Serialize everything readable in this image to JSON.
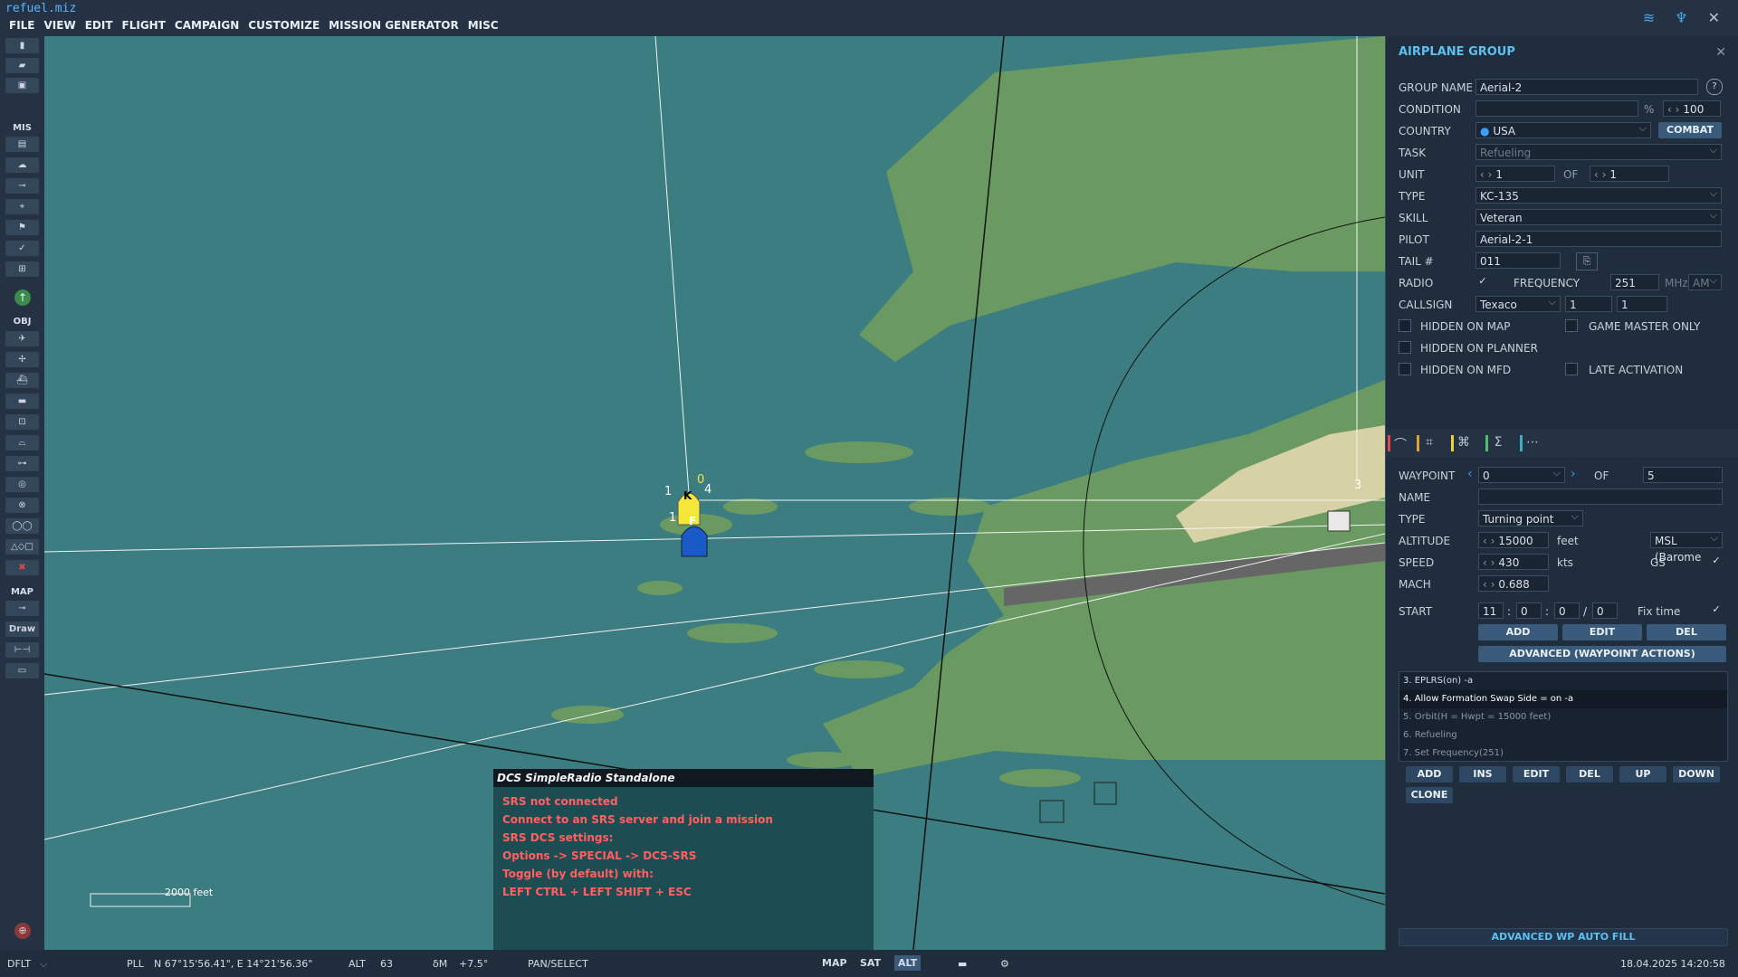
{
  "app": {
    "title": "refuel.miz",
    "menu": [
      "FILE",
      "VIEW",
      "EDIT",
      "FLIGHT",
      "CAMPAIGN",
      "CUSTOMIZE",
      "MISSION GENERATOR",
      "MISC"
    ]
  },
  "left_toolbar": {
    "section_mis": "MIS",
    "section_obj": "OBJ",
    "section_map": "MAP",
    "draw_label": "Draw"
  },
  "map": {
    "scale_label": "2000 feet",
    "group_labels": {
      "k_marker": "K",
      "f_marker": "F",
      "num1": "1",
      "num0": "0",
      "num4": "4",
      "num1b": "1",
      "num3": "3"
    }
  },
  "srs_overlay": {
    "title": "DCS SimpleRadio Standalone",
    "lines": [
      "SRS not connected",
      "Connect to an SRS server and join a mission",
      "SRS DCS settings:",
      "Options -> SPECIAL -> DCS-SRS",
      "Toggle (by default) with:",
      "LEFT CTRL + LEFT SHIFT + ESC"
    ]
  },
  "panel": {
    "title": "AIRPLANE GROUP",
    "group_name_label": "GROUP NAME",
    "group_name": "Aerial-2",
    "condition_label": "CONDITION",
    "condition_pct": "%",
    "condition_value": "100",
    "country_label": "COUNTRY",
    "country": "USA",
    "combat_button": "COMBAT",
    "task_label": "TASK",
    "task": "Refueling",
    "unit_label": "UNIT",
    "unit_value": "1",
    "unit_of": "OF",
    "unit_total": "1",
    "type_label": "TYPE",
    "type": "KC-135",
    "skill_label": "SKILL",
    "skill": "Veteran",
    "pilot_label": "PILOT",
    "pilot": "Aerial-2-1",
    "tail_label": "TAIL #",
    "tail": "011",
    "radio_label": "RADIO",
    "frequency_label": "FREQUENCY",
    "frequency": "251",
    "mhz": "MHz",
    "modulation": "AM",
    "callsign_label": "CALLSIGN",
    "callsign": "Texaco",
    "callsign_n1": "1",
    "callsign_n2": "1",
    "hidden_map": "HIDDEN ON MAP",
    "gm_only": "GAME MASTER ONLY",
    "hidden_planner": "HIDDEN ON PLANNER",
    "hidden_mfd": "HIDDEN ON MFD",
    "late_activation": "LATE ACTIVATION",
    "waypoint_label": "WAYPOINT",
    "waypoint": "0",
    "waypoint_of": "OF",
    "waypoint_total": "5",
    "name_label": "NAME",
    "wp_type_label": "TYPE",
    "wp_type": "Turning point",
    "altitude_label": "ALTITUDE",
    "altitude": "15000",
    "altitude_unit": "feet",
    "altitude_ref": "MSL (Barome",
    "speed_label": "SPEED",
    "speed": "430",
    "speed_unit": "kts",
    "gs_label": "GS",
    "mach_label": "MACH",
    "mach": "0.688",
    "start_label": "START",
    "start_h": "11",
    "start_m": "0",
    "start_s": "0",
    "start_d": "0",
    "fix_time": "Fix time",
    "sep_colon1": ":",
    "sep_colon2": ":",
    "sep_slash": "/",
    "add": "ADD",
    "edit": "EDIT",
    "del": "DEL",
    "advanced_wp": "ADVANCED (WAYPOINT ACTIONS)",
    "actions": [
      "3. EPLRS(on)  -a",
      "4. Allow Formation Swap Side = on -a",
      "5. Orbit(H = Hwpt = 15000 feet)",
      "6. Refueling",
      "7. Set Frequency(251)"
    ],
    "act_add": "ADD",
    "act_ins": "INS",
    "act_edit": "EDIT",
    "act_del": "DEL",
    "act_up": "UP",
    "act_down": "DOWN",
    "act_clone": "CLONE",
    "auto_fill": "ADVANCED WP AUTO FILL"
  },
  "status": {
    "dflt": "DFLT",
    "pll": "PLL",
    "coords": "N 67°15'56.41\", E 14°21'56.36\"",
    "alt_label": "ALT",
    "alt": "63",
    "dm_label": "δM",
    "dm": "+7.5°",
    "mode": "PAN/SELECT",
    "map_btn": "MAP",
    "sat_btn": "SAT",
    "alt_btn": "ALT",
    "datetime": "18.04.2025 14:20:58"
  },
  "colors": {
    "accent": "#5cc0f0",
    "map_sea": "#3b7d80",
    "land": "#6a9a62",
    "warning": "#ff6060"
  }
}
